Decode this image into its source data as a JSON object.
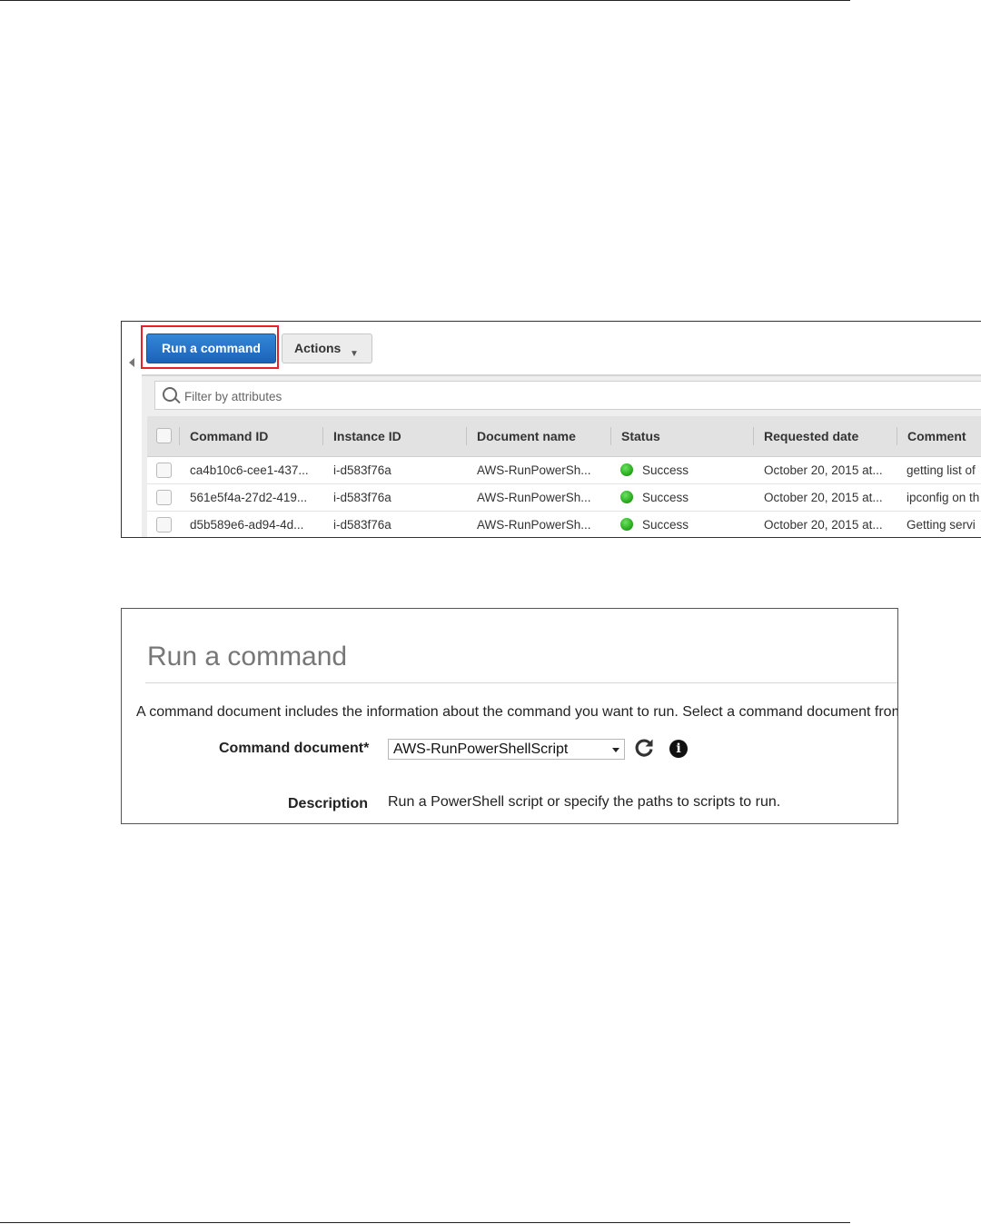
{
  "toolbar": {
    "run_command_label": "Run a command",
    "actions_label": "Actions"
  },
  "filter": {
    "placeholder": "Filter by attributes"
  },
  "table": {
    "headers": {
      "command_id": "Command ID",
      "instance_id": "Instance ID",
      "document_name": "Document name",
      "status": "Status",
      "requested_date": "Requested date",
      "comment": "Comment"
    },
    "rows": [
      {
        "command_id": "ca4b10c6-cee1-437...",
        "instance_id": "i-d583f76a",
        "document_name": "AWS-RunPowerSh...",
        "status": "Success",
        "requested_date": "October 20, 2015 at...",
        "comment": "getting list of"
      },
      {
        "command_id": "561e5f4a-27d2-419...",
        "instance_id": "i-d583f76a",
        "document_name": "AWS-RunPowerSh...",
        "status": "Success",
        "requested_date": "October 20, 2015 at...",
        "comment": "ipconfig on th"
      },
      {
        "command_id": "d5b589e6-ad94-4d...",
        "instance_id": "i-d583f76a",
        "document_name": "AWS-RunPowerSh...",
        "status": "Success",
        "requested_date": "October 20, 2015 at...",
        "comment": "Getting servi"
      }
    ],
    "status_color": "#2fb52a"
  },
  "run_command": {
    "title": "Run a command",
    "description": "A command document includes the information about the command you want to run. Select a command document from",
    "command_document_label": "Command document*",
    "command_document_value": "AWS-RunPowerShellScript",
    "description_label": "Description",
    "description_value": "Run a PowerShell script or specify the paths to scripts to run."
  },
  "colors": {
    "primary_button": "#1f6fc5",
    "highlight_border": "#e8202a"
  }
}
